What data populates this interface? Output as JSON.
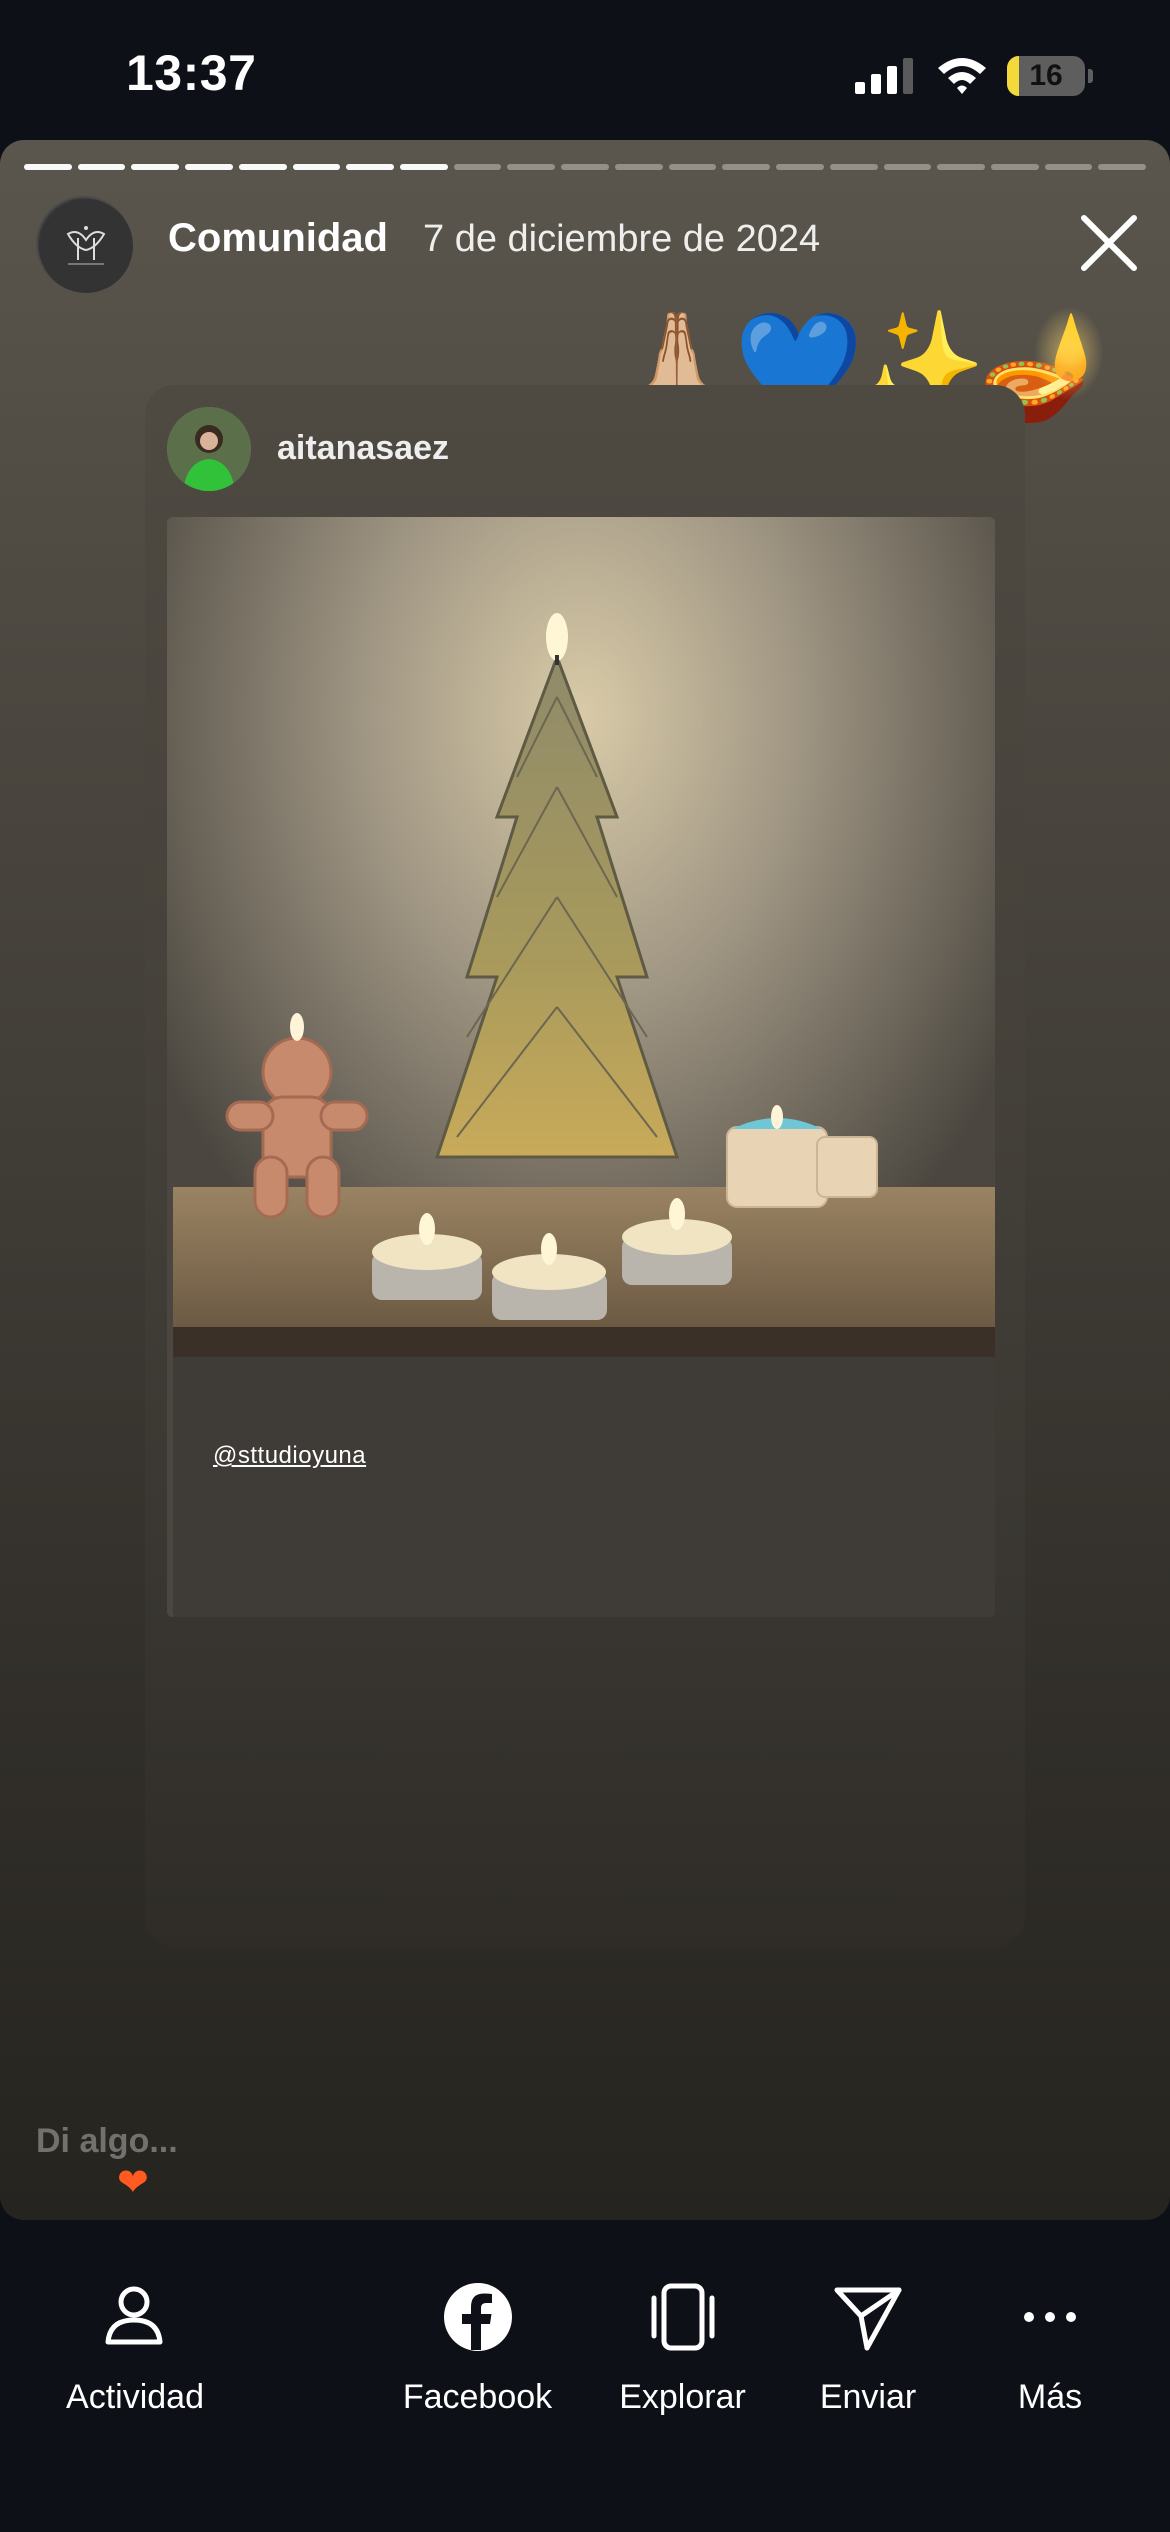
{
  "status_bar": {
    "time": "13:37",
    "battery_level": "16",
    "battery_fraction": 0.16,
    "battery_color": "#f4d93a"
  },
  "story": {
    "progress": {
      "segments": 21,
      "completed": 8
    },
    "account_name": "Comunidad",
    "date": "7 de diciembre de 2024",
    "stickers": [
      "🙏🏼",
      "💙",
      "✨",
      "🪔"
    ],
    "reposted_post": {
      "username": "aitanasaez",
      "photo_tag": "@sttudioyuna"
    }
  },
  "reply": {
    "placeholder": "Di algo...",
    "reaction_icon": "heart-icon",
    "reaction_color": "#ff5a1f"
  },
  "bottom_nav": {
    "items": [
      {
        "label": "Actividad",
        "icon": "activity-icon"
      },
      {
        "label": "Facebook",
        "icon": "facebook-icon"
      },
      {
        "label": "Explorar",
        "icon": "explore-icon"
      },
      {
        "label": "Enviar",
        "icon": "send-icon"
      },
      {
        "label": "Más",
        "icon": "more-icon"
      }
    ]
  }
}
